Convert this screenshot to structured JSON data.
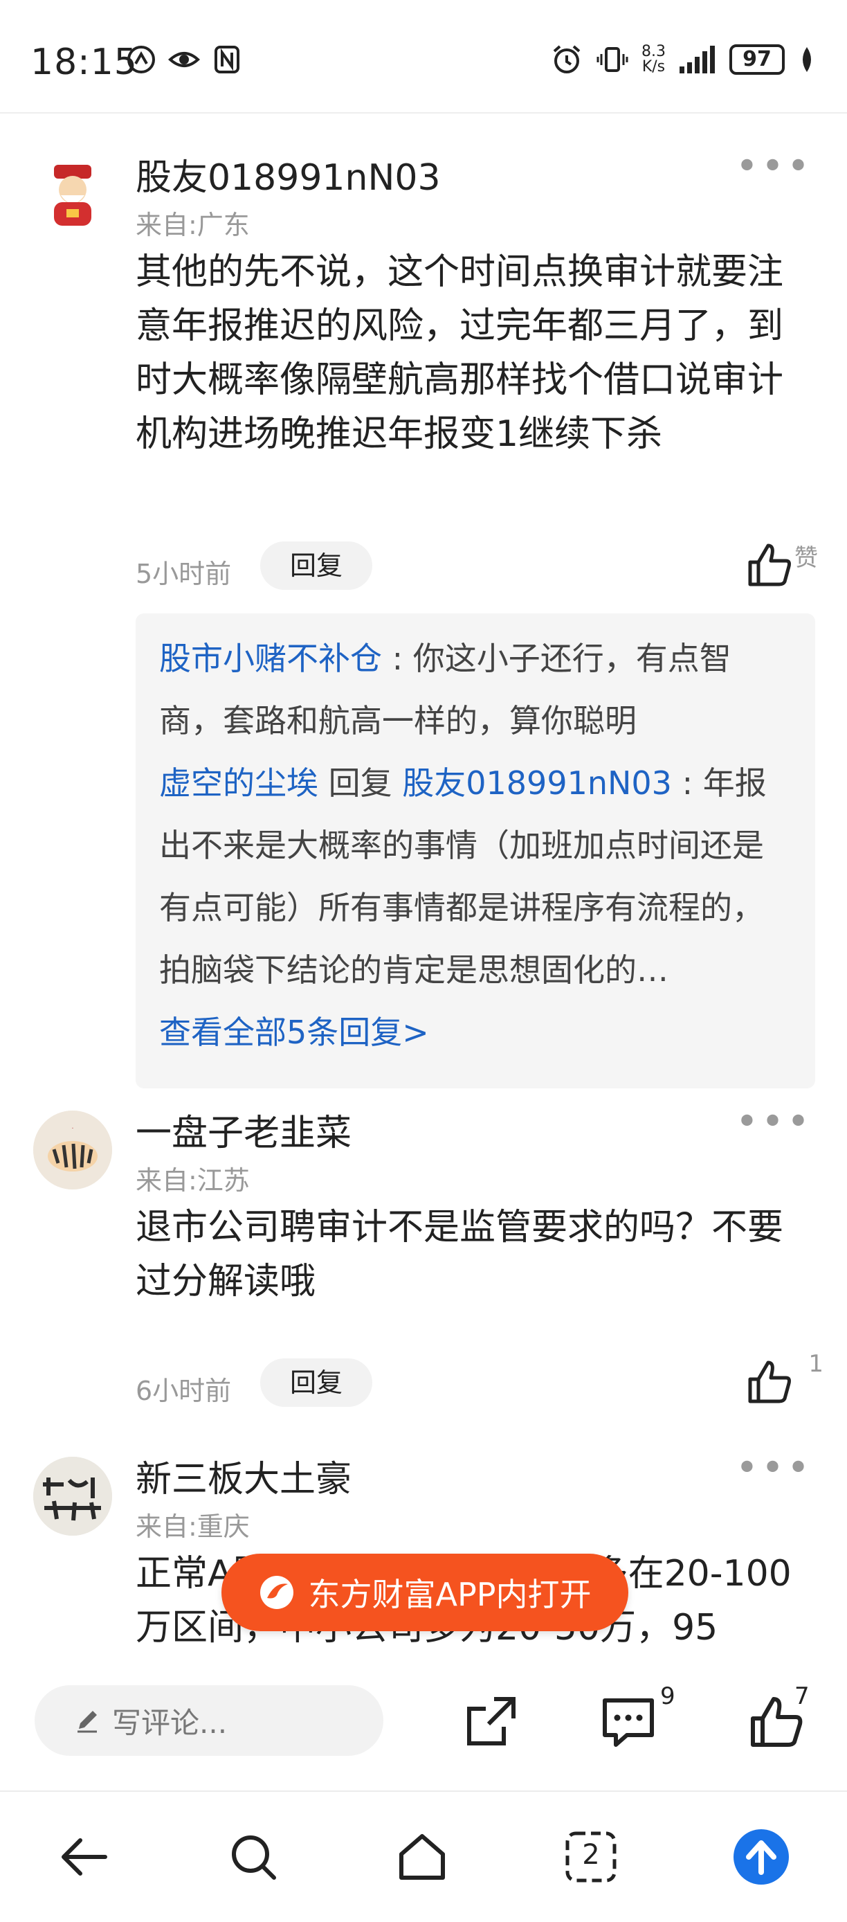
{
  "status_bar": {
    "time": "18:15",
    "net_speed_value": "8.3",
    "net_speed_unit": "K/s",
    "battery": "97"
  },
  "comments": [
    {
      "username": "股友018991nN03",
      "location": "来自:广东",
      "text": "其他的先不说，这个时间点换审计就要注意年报推迟的风险，过完年都三月了，到时大概率像隔壁航高那样找个借口说审计机构进场晚推迟年报变1继续下杀",
      "time": "5小时前",
      "reply_label": "回复",
      "like_label": "赞",
      "replies": [
        {
          "author": "股市小赌不补仓",
          "text": " : 你这小子还行，有点智商，套路和航高一样的，算你聪明"
        },
        {
          "author": "虚空的尘埃",
          "reply_word": " 回复 ",
          "target": "股友018991nN03",
          "text": " : 年报出不来是大概率的事情（加班加点时间还是有点可能）所有事情都是讲程序有流程的，拍脑袋下结论的肯定是思想固化的…"
        }
      ],
      "view_all": "查看全部5条回复>"
    },
    {
      "username": "一盘子老韭菜",
      "location": "来自:江苏",
      "text": "退市公司聘审计不是监管要求的吗？不要过分解读哦",
      "time": "6小时前",
      "reply_label": "回复",
      "like_count": "1"
    },
    {
      "username": "新三板大土豪",
      "location": "来自:重庆",
      "text": "正常A股上市公司年报审计费多在20-100万区间，中小公司多为20-50万，95"
    }
  ],
  "open_app_label": "东方财富APP内打开",
  "comment_bar": {
    "placeholder": "写评论...",
    "comment_count": "9",
    "like_count": "7"
  },
  "nav": {
    "tabs_count": "2"
  },
  "colors": {
    "accent_orange": "#f5531f",
    "link_blue": "#1e63c4",
    "nav_blue": "#1a73e8"
  }
}
